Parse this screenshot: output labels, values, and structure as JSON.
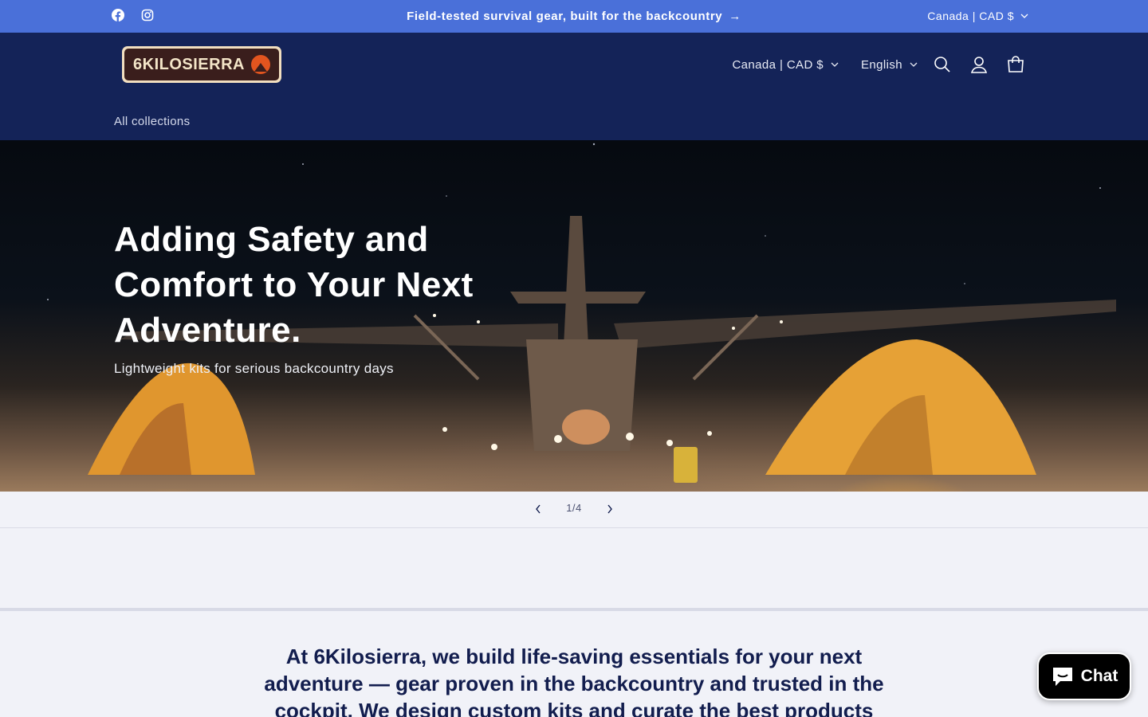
{
  "announcement": {
    "message": "Field-tested survival gear, built for the backcountry",
    "arrow": "→",
    "locale": "Canada | CAD $",
    "social_icons": [
      "facebook-icon",
      "instagram-icon"
    ]
  },
  "header": {
    "logo_text": "6KILOSIERRA",
    "country_selector": "Canada | CAD $",
    "language_selector": "English",
    "icons": [
      "search-icon",
      "account-icon",
      "cart-icon"
    ],
    "nav": {
      "all_collections": "All collections"
    }
  },
  "hero": {
    "heading": "Adding Safety and Comfort to Your Next Adventure.",
    "subheading": "Lightweight kits for serious backcountry days"
  },
  "slider": {
    "counter": "1/4",
    "prev_icon": "chevron-left-icon",
    "next_icon": "chevron-right-icon"
  },
  "about": {
    "text": "At 6Kilosierra, we build life-saving essentials for your next adventure — gear proven in the backcountry and trusted in the cockpit. We design custom kits and curate the best products"
  },
  "chat": {
    "label": "Chat",
    "icon": "chat-bubble-icon"
  },
  "colors": {
    "announcement_bg": "#4a70d9",
    "header_bg": "#142358",
    "page_bg": "#f1f2f8",
    "text": "#121d4e"
  }
}
